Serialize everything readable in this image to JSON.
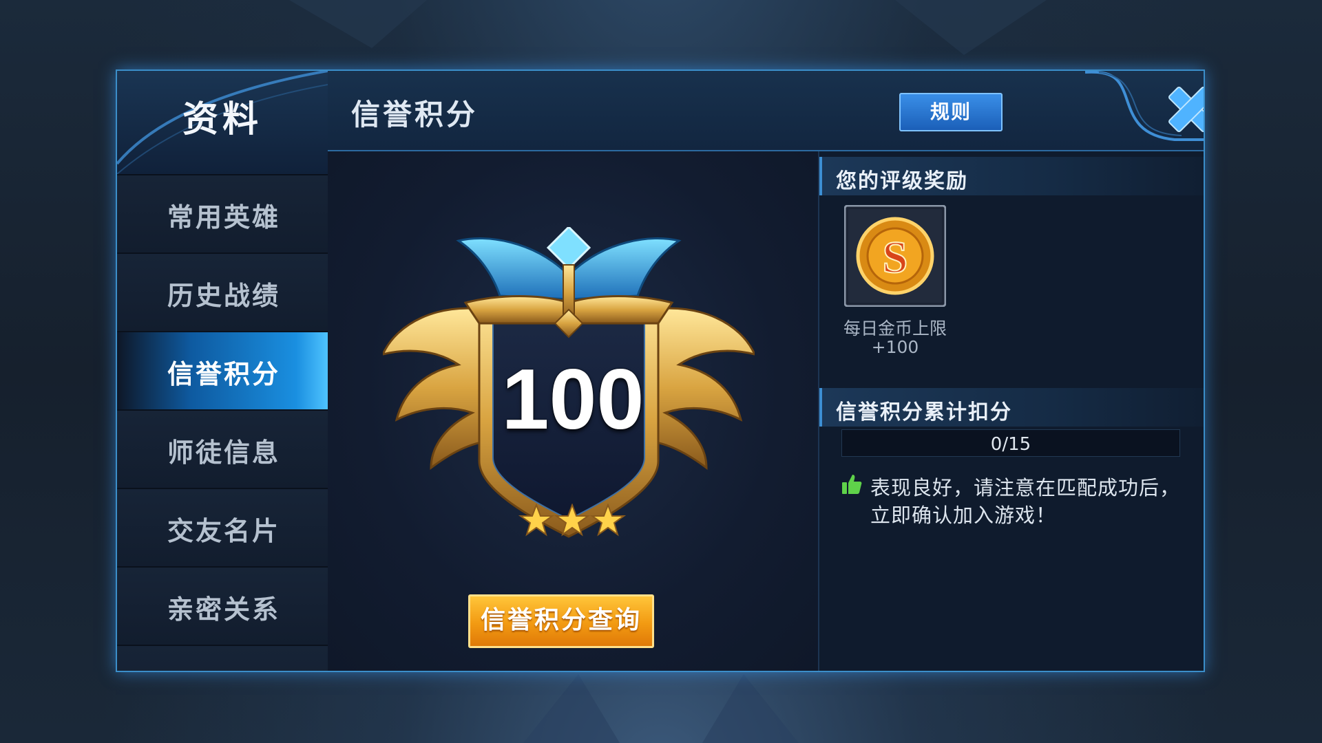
{
  "sidebar": {
    "title": "资料",
    "items": [
      {
        "label": "常用英雄",
        "active": false
      },
      {
        "label": "历史战绩",
        "active": false
      },
      {
        "label": "信誉积分",
        "active": true
      },
      {
        "label": "师徒信息",
        "active": false
      },
      {
        "label": "交友名片",
        "active": false
      },
      {
        "label": "亲密关系",
        "active": false
      }
    ]
  },
  "header": {
    "title": "信誉积分",
    "rules_label": "规则",
    "close_icon": "close-x-icon"
  },
  "credit": {
    "score": "100",
    "stars": 3,
    "query_label": "信誉积分查询"
  },
  "reward": {
    "heading": "您的评级奖励",
    "icon": "gold-coin-s-icon",
    "label": "每日金币上限",
    "value": "+100"
  },
  "deduction": {
    "heading": "信誉积分累计扣分",
    "progress_text": "0/15",
    "progress_fraction": 0,
    "message_line1": "表现良好，请注意在匹配成功后，",
    "message_line2": "立即确认加入游戏！",
    "message_icon": "thumbs-up-icon"
  },
  "colors": {
    "accent_blue": "#3d8fd3",
    "button_orange": "#f29a12",
    "thumb_green": "#5fd24a"
  }
}
